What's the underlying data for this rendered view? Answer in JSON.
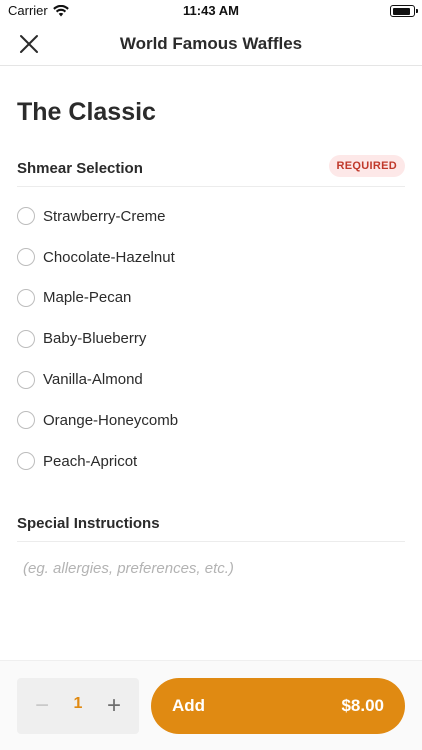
{
  "status_bar": {
    "carrier": "Carrier",
    "time": "11:43 AM",
    "battery_level": 0.9,
    "icons": [
      "wifi-icon",
      "battery-icon"
    ]
  },
  "nav": {
    "title": "World Famous Waffles",
    "close_icon": "close-icon"
  },
  "item": {
    "title": "The Classic"
  },
  "shmear": {
    "title": "Shmear Selection",
    "badge": "REQUIRED",
    "options": [
      {
        "label": "Strawberry-Creme",
        "selected": false
      },
      {
        "label": "Chocolate-Hazelnut",
        "selected": false
      },
      {
        "label": "Maple-Pecan",
        "selected": false
      },
      {
        "label": "Baby-Blueberry",
        "selected": false
      },
      {
        "label": "Vanilla-Almond",
        "selected": false
      },
      {
        "label": "Orange-Honeycomb",
        "selected": false
      },
      {
        "label": "Peach-Apricot",
        "selected": false
      }
    ]
  },
  "instructions": {
    "title": "Special Instructions",
    "value": "",
    "placeholder": "(eg. allergies, preferences, etc.)"
  },
  "order": {
    "quantity": "1",
    "minus_icon": "minus-icon",
    "plus_icon": "plus-icon",
    "add_label": "Add",
    "price": "$8.00"
  },
  "colors": {
    "accent": "#e08a12",
    "badge_bg": "#fde8e8",
    "badge_text": "#c0392b",
    "text": "#2b2b2b"
  }
}
